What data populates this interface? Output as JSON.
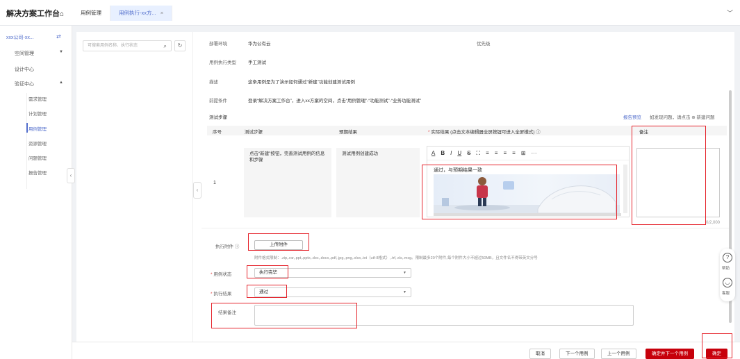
{
  "app": {
    "title": "解决方案工作台",
    "home_icon": "⌂"
  },
  "tabs": [
    {
      "label": "用例管理"
    },
    {
      "label": "用例执行-xx方...",
      "close": "×"
    }
  ],
  "sidebar": {
    "project": "xxx公司-xx...",
    "groups": [
      {
        "label": "空间管理",
        "caret": "▼"
      },
      {
        "label": "设计中心"
      },
      {
        "label": "验证中心",
        "caret": "▲"
      }
    ],
    "sub_items": [
      "需求管理",
      "计划管理",
      "用例管理",
      "资源管理",
      "问题管理",
      "报告管理"
    ]
  },
  "tree": {
    "search_placeholder": "可搜索用例名称、执行状态"
  },
  "detail": {
    "deploy_env_label": "部署环境",
    "deploy_env_value": "华为公有云",
    "priority_label": "优先级",
    "exec_type_label": "用例执行类型",
    "exec_type_value": "手工测试",
    "desc_label": "描述",
    "desc_value": "这条用例是为了演示如何通过“新建”功能创建测试用例",
    "precond_label": "前提条件",
    "precond_value": "登录“解决方案工作台”，进入xx方案的空间，点击“用例管理”-“功能测试”-“业务功能测试”"
  },
  "steps": {
    "title": "测试步骤",
    "link_preview": "报告预览",
    "link_issue": "如发现问题，请点击 ⊕ 新建问题",
    "headers": {
      "num": "序号",
      "step": "测试步骤",
      "expected": "预期结果",
      "actual": "实际结果 (点击文本编辑器全屏按钮可进入全屏模式)",
      "memo": "备注"
    },
    "row": {
      "num": "1",
      "step": "点击“新建”按钮，完善测试用例的信息和步骤",
      "expected": "测试用例创建成功",
      "actual_text": "通过，与预期结果一致",
      "memo_count": "0/2,000"
    }
  },
  "form": {
    "attachment_label": "执行附件",
    "upload_label": "上传附件",
    "upload_hint": "附件格式限制：.zip,.rar,.ppt,.pptx,.doc,.docx,.pdf,.jpg,.png,.xlsx,.txt（utf-8格式）,.trf,.xls,.msg。限制最多20个附件,每个附件大小不超过50MB，且文件名不得带英文分号",
    "status_label": "用例状态",
    "status_value": "执行完毕",
    "result_label": "执行结果",
    "result_value": "通过",
    "remark_label": "结果备注"
  },
  "help": {
    "help_label": "帮助",
    "service_label": "客服"
  },
  "footer": {
    "cancel": "取消",
    "next": "下一个用例",
    "prev": "上一个用例",
    "confirm_next": "确定并下一个用例",
    "confirm": "确定"
  },
  "colors": {
    "primary": "#c7000b",
    "accent": "#526ecc",
    "annotation": "#e5222a"
  }
}
